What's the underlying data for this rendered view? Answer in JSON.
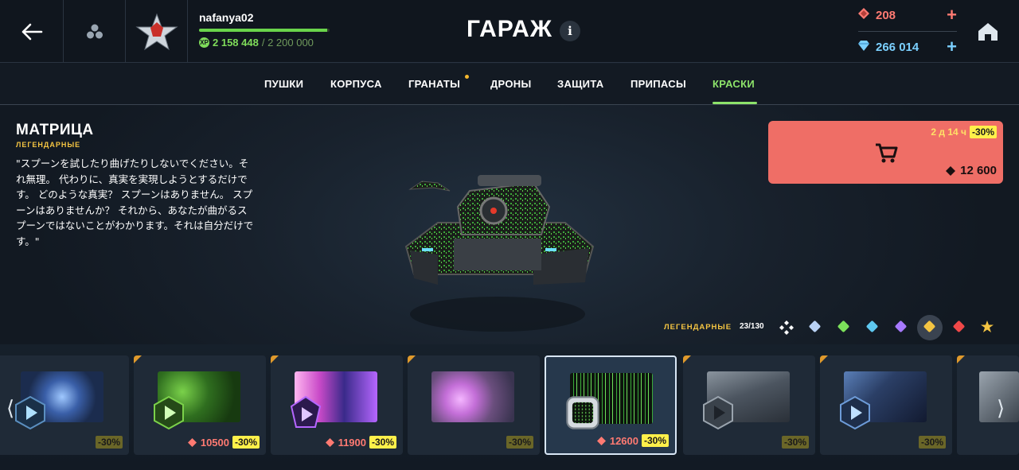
{
  "header": {
    "player_name": "nafanya02",
    "xp_current": "2 158 448",
    "xp_max": "/ 2 200 000",
    "xp_progress": 0.981,
    "title": "ГАРАЖ",
    "info": "i",
    "rubies": "208",
    "crystals": "266 014",
    "ruby_color": "#ff7a72",
    "crystal_color": "#7bd0ff"
  },
  "tabs": [
    {
      "label": "ПУШКИ"
    },
    {
      "label": "КОРПУСА"
    },
    {
      "label": "ГРАНАТЫ"
    },
    {
      "label": "ДРОНЫ"
    },
    {
      "label": "ЗАЩИТА"
    },
    {
      "label": "ПРИПАСЫ"
    },
    {
      "label": "КРАСКИ",
      "active": true
    }
  ],
  "item": {
    "name": "МАТРИЦА",
    "rarity": "ЛЕГЕНДАРНЫЕ",
    "description": "\"スプーンを試したり曲げたりしないでください。それ無理。 代わりに、真実を実現しようとするだけです。 どのような真実？ スプーンはありません。 スプーンはありませんか？ それから、あなたが曲がるスプーンではないことがわかります。それは自分だけです。\""
  },
  "buy": {
    "timer": "2 д 14 ч",
    "discount": "-30%",
    "price": "12 600",
    "bg_color": "#ef6e66"
  },
  "filter": {
    "label": "ЛЕГЕНДАРНЫЕ",
    "count": "23/130"
  },
  "cards": [
    {
      "price": "",
      "discount": "-30%"
    },
    {
      "price": "10500",
      "discount": "-30%"
    },
    {
      "price": "11900",
      "discount": "-30%"
    },
    {
      "price": "",
      "discount": "-30%"
    },
    {
      "price": "12600",
      "discount": "-30%",
      "selected": true
    },
    {
      "price": "",
      "discount": "-30%"
    },
    {
      "price": "",
      "discount": "-30%"
    }
  ]
}
